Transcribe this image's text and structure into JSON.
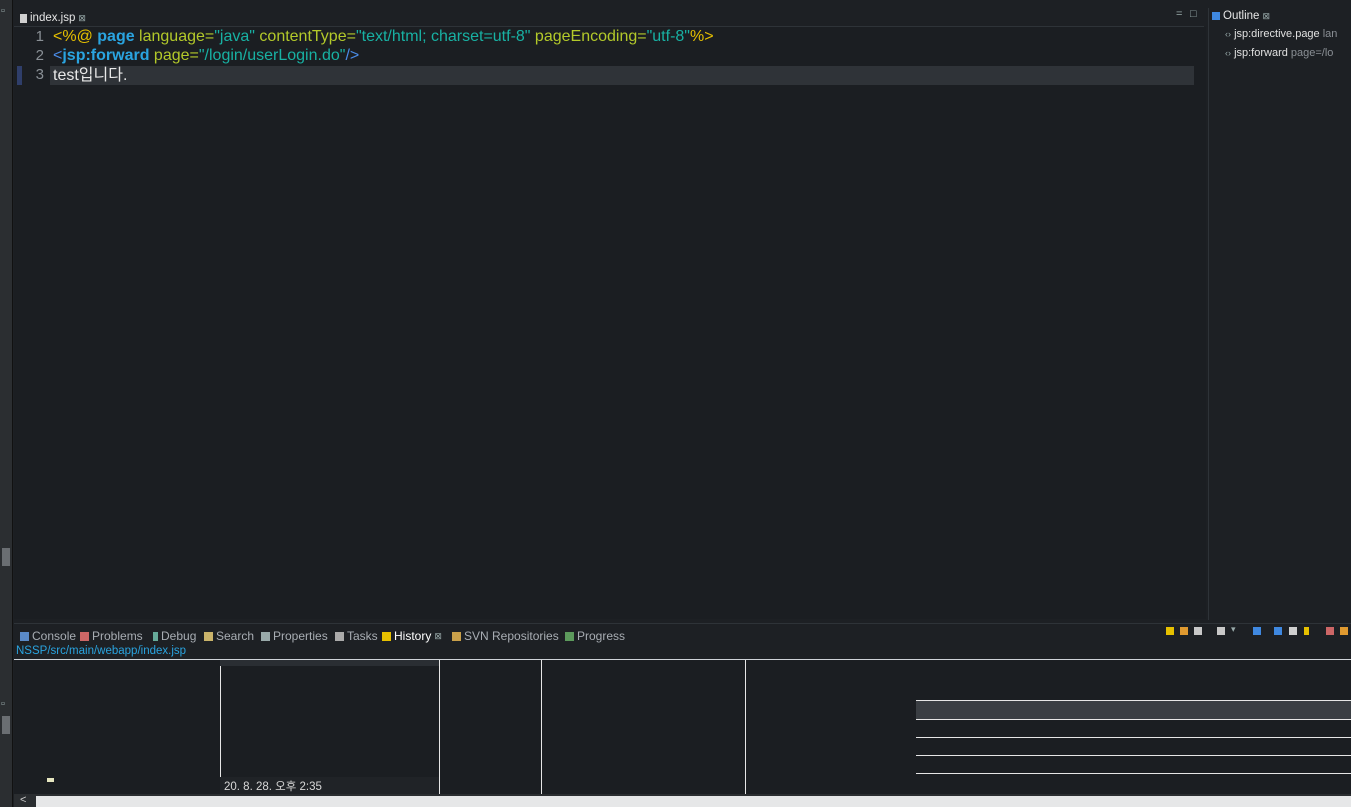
{
  "editor": {
    "tab_label": "index.jsp",
    "tab_close": "⊠",
    "lines": [
      {
        "num": "1"
      },
      {
        "num": "2"
      },
      {
        "num": "3"
      }
    ],
    "line1": {
      "open": "<%@ ",
      "kw": "page",
      "a1": " language=",
      "v1": "\"java\"",
      "a2": " contentType=",
      "v2": "\"text/html; charset=utf-8\"",
      "a3": " pageEncoding=",
      "v3": "\"utf-8\"",
      "close": "%>"
    },
    "line2": {
      "open": "<",
      "kw": "jsp:forward",
      "a1": " page=",
      "v1": "\"/login/userLogin.do\"",
      "close": "/>"
    },
    "line3": {
      "text": "test입니다."
    }
  },
  "outline": {
    "title": "Outline",
    "close": "⊠",
    "items": [
      {
        "name": "jsp:directive.page",
        "detail": " lan"
      },
      {
        "name": "jsp:forward",
        "detail": " page=/lo"
      }
    ]
  },
  "bottom": {
    "tabs": [
      {
        "label": "Console"
      },
      {
        "label": "Problems"
      },
      {
        "label": "Debug"
      },
      {
        "label": "Search"
      },
      {
        "label": "Properties"
      },
      {
        "label": "Tasks"
      },
      {
        "label": "History",
        "close": "⊠"
      },
      {
        "label": "SVN Repositories"
      },
      {
        "label": "Progress"
      }
    ],
    "history_path": "NSSP/src/main/webapp/index.jsp",
    "history_row_date": "20. 8. 28. 오후 2:35",
    "scroll_left": "<"
  },
  "colors": {
    "background": "#1d2024",
    "keyword_blue": "#2aa4e0",
    "attr_green": "#b3c92a",
    "string_teal": "#18b1a3",
    "delimiter_yellow": "#e6c000"
  }
}
